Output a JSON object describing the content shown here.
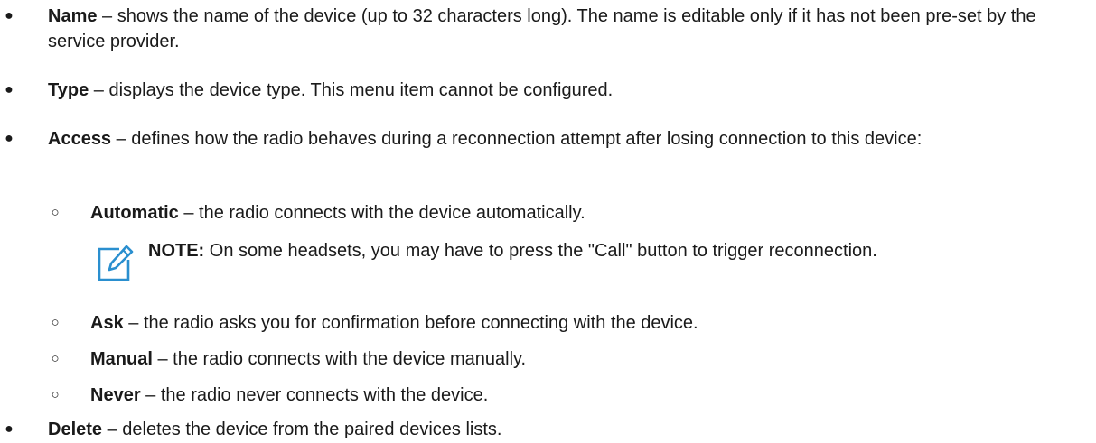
{
  "items": [
    {
      "term": "Name",
      "description": " – shows the name of the device (up to 32 characters long). The name is editable only if it has not been pre-set by the service provider."
    },
    {
      "term": "Type",
      "description": " – displays the device type. This menu item cannot be configured."
    },
    {
      "term": "Access",
      "description": " – defines how the radio behaves during a reconnection attempt after losing connection to this device:"
    },
    {
      "term": "Delete",
      "description": " – deletes the device from the paired devices lists."
    }
  ],
  "access_options": [
    {
      "term": "Automatic",
      "description": " – the radio connects with the device automatically."
    },
    {
      "term": "Ask",
      "description": " – the radio asks you for confirmation before connecting with the device."
    },
    {
      "term": "Manual",
      "description": " – the radio connects with the device manually."
    },
    {
      "term": "Never",
      "description": " – the radio never connects with the device."
    }
  ],
  "note": {
    "label": "NOTE:",
    "text": " On some headsets, you may have to press the \"Call\" button to trigger reconnection."
  },
  "symbols": {
    "bullet": "●",
    "sub_bullet": "○"
  },
  "colors": {
    "note_icon": "#2a8fcf",
    "text": "#1a1a1a"
  }
}
